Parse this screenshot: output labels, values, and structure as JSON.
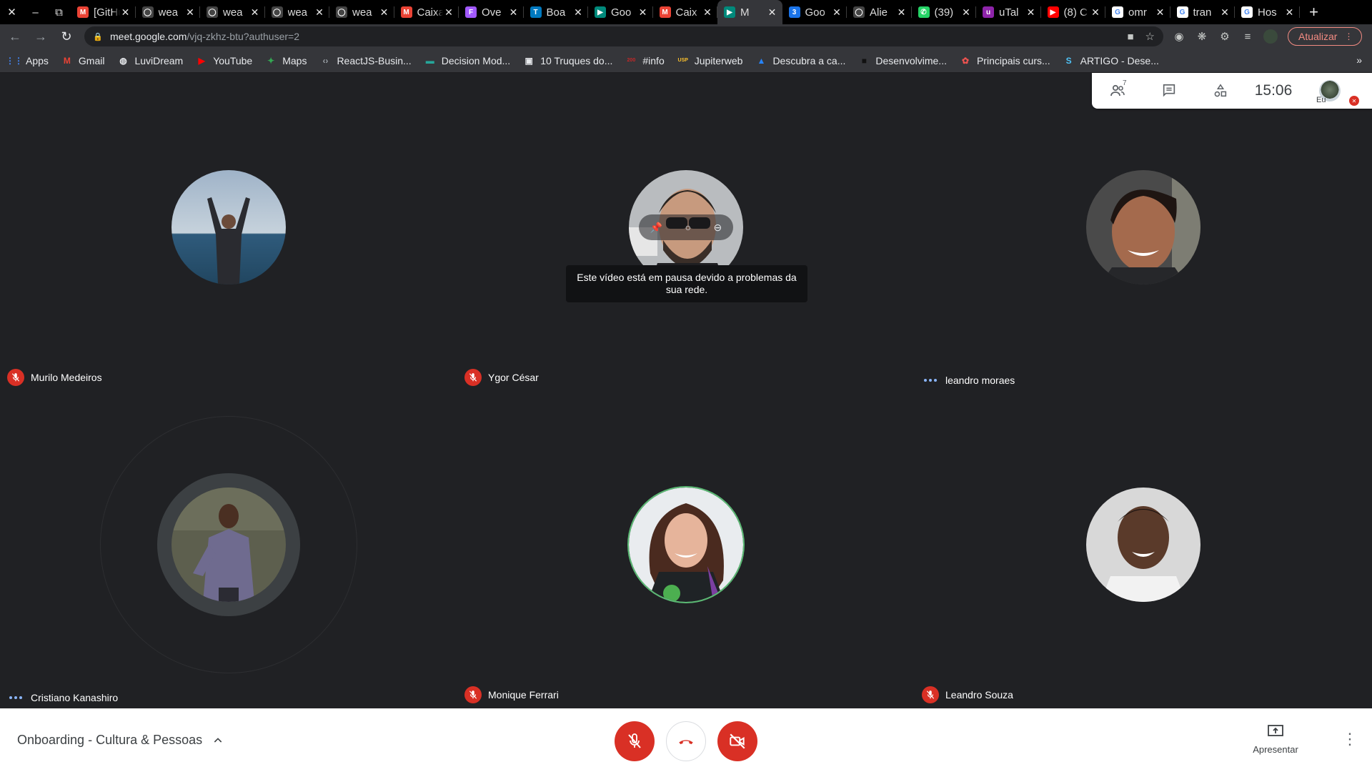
{
  "browser": {
    "window_controls": [
      "✕",
      "–",
      "⧉"
    ],
    "tabs": [
      {
        "title": "[GitHub]",
        "icon": "gmail-icon",
        "color": "#ea4335",
        "glyph": "M"
      },
      {
        "title": "wea",
        "icon": "github-icon",
        "color": "#444",
        "glyph": "◯"
      },
      {
        "title": "wea",
        "icon": "github-icon",
        "color": "#444",
        "glyph": "◯"
      },
      {
        "title": "wea",
        "icon": "github-icon",
        "color": "#444",
        "glyph": "◯"
      },
      {
        "title": "wea",
        "icon": "github-icon",
        "color": "#444",
        "glyph": "◯"
      },
      {
        "title": "Caixa",
        "icon": "gmail-icon",
        "color": "#ea4335",
        "glyph": "M"
      },
      {
        "title": "Ove",
        "icon": "figma-icon",
        "color": "#a259ff",
        "glyph": "F"
      },
      {
        "title": "Boa",
        "icon": "trello-icon",
        "color": "#0079bf",
        "glyph": "T"
      },
      {
        "title": "Goo",
        "icon": "meet-icon",
        "color": "#00897b",
        "glyph": "▶"
      },
      {
        "title": "Caix",
        "icon": "gmail-icon",
        "color": "#ea4335",
        "glyph": "M"
      },
      {
        "title": "M",
        "icon": "meet-recording-icon",
        "color": "#00897b",
        "glyph": "▶",
        "active": true
      },
      {
        "title": "Goo",
        "icon": "calendar-icon",
        "color": "#1a73e8",
        "glyph": "3"
      },
      {
        "title": "Alie",
        "icon": "github-icon",
        "color": "#444",
        "glyph": "◯"
      },
      {
        "title": "(39)",
        "icon": "whatsapp-icon",
        "color": "#25d366",
        "glyph": "✆"
      },
      {
        "title": "uTal",
        "icon": "utalk-icon",
        "color": "#8e24aa",
        "glyph": "u"
      },
      {
        "title": "(8) C",
        "icon": "youtube-icon",
        "color": "#ff0000",
        "glyph": "▶"
      },
      {
        "title": "omr",
        "icon": "google-icon",
        "color": "#ffffff",
        "glyph": "G"
      },
      {
        "title": "tran",
        "icon": "google-icon",
        "color": "#ffffff",
        "glyph": "G"
      },
      {
        "title": "Hos",
        "icon": "google-icon",
        "color": "#ffffff",
        "glyph": "G"
      }
    ],
    "tab_close": "✕",
    "new_tab": "+",
    "url_host": "meet.google.com",
    "url_path": "/vjq-zkhz-btu?authuser=2",
    "update_label": "Atualizar",
    "bookmarks": [
      {
        "label": "Apps",
        "icon": "apps-grid-icon",
        "color": "#4285f4",
        "glyph": "⋮⋮"
      },
      {
        "label": "Gmail",
        "icon": "gmail-icon",
        "color": "#ea4335",
        "glyph": "M"
      },
      {
        "label": "LuviDream",
        "icon": "globe-icon",
        "color": "#e8eaed",
        "glyph": "◍"
      },
      {
        "label": "YouTube",
        "icon": "youtube-icon",
        "color": "#ff0000",
        "glyph": "▶"
      },
      {
        "label": "Maps",
        "icon": "maps-icon",
        "color": "#34a853",
        "glyph": "✦"
      },
      {
        "label": "ReactJS-Busin...",
        "icon": "code-icon",
        "color": "#9aa0a6",
        "glyph": "‹›"
      },
      {
        "label": "Decision Mod...",
        "icon": "bookmark-icon",
        "color": "#26a69a",
        "glyph": "▬"
      },
      {
        "label": "10 Truques do...",
        "icon": "page-icon",
        "color": "#e8eaed",
        "glyph": "▣"
      },
      {
        "label": "#info",
        "icon": "info-site-icon",
        "color": "#c62828",
        "glyph": "200"
      },
      {
        "label": "Jupiterweb",
        "icon": "usp-icon",
        "color": "#fbc02d",
        "glyph": "USP"
      },
      {
        "label": "Descubra a ca...",
        "icon": "atlassian-icon",
        "color": "#2684ff",
        "glyph": "▲"
      },
      {
        "label": "Desenvolvime...",
        "icon": "site-icon",
        "color": "#111111",
        "glyph": "■"
      },
      {
        "label": "Principais curs...",
        "icon": "site-icon",
        "color": "#ef5350",
        "glyph": "✿"
      },
      {
        "label": "ARTIGO - Dese...",
        "icon": "site-icon",
        "color": "#4fc3f7",
        "glyph": "S"
      }
    ],
    "bookmarks_more": "»"
  },
  "meet": {
    "participant_count": "7",
    "clock": "15:06",
    "self_label": "Eu",
    "pause_message": "Este vídeo está em pausa devido a problemas da sua rede.",
    "participants": [
      {
        "name": "Murilo Medeiros",
        "muted": true,
        "speaking": false
      },
      {
        "name": "Ygor César",
        "muted": true,
        "speaking": false
      },
      {
        "name": "leandro moraes",
        "muted": false,
        "speaking": true
      },
      {
        "name": "Cristiano Kanashiro",
        "muted": false,
        "speaking": true
      },
      {
        "name": "Monique Ferrari",
        "muted": true,
        "speaking": false
      },
      {
        "name": "Leandro Souza",
        "muted": true,
        "speaking": false
      }
    ],
    "meeting_title": "Onboarding - Cultura & Pessoas",
    "present_label": "Apresentar",
    "colors": {
      "danger": "#d93025",
      "speaking_dots": "#8ab4f8",
      "stage_bg": "#202124"
    }
  }
}
